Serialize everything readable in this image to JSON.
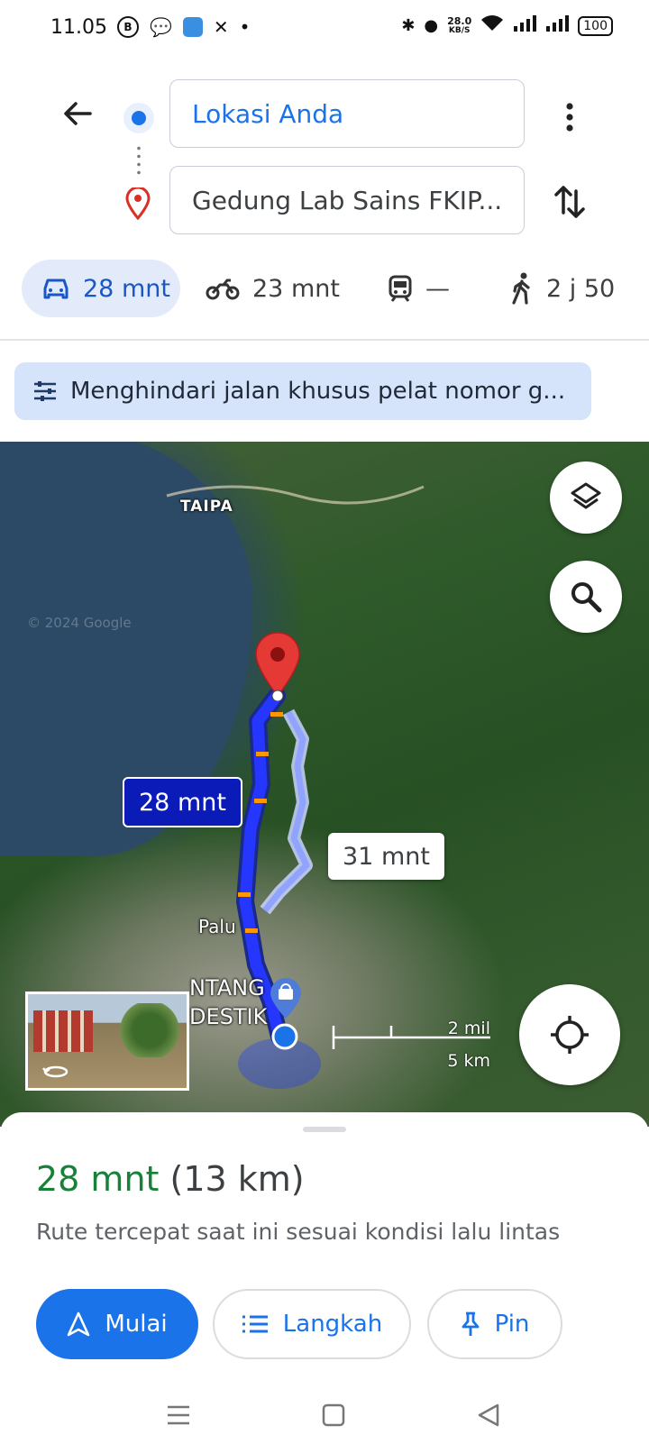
{
  "status_bar": {
    "time": "11.05",
    "speed_value": "28.0",
    "speed_unit": "KB/S",
    "battery": "100"
  },
  "directions": {
    "origin": "Lokasi Anda",
    "destination": "Gedung Lab Sains FKIP..."
  },
  "modes": [
    {
      "name": "car",
      "label": "28 mnt",
      "active": true
    },
    {
      "name": "motorcycle",
      "label": "23 mnt",
      "active": false
    },
    {
      "name": "transit",
      "label": "—",
      "active": false
    },
    {
      "name": "walk",
      "label": "2 j 50",
      "active": false
    }
  ],
  "options_chip": "Menghindari jalan khusus pelat nomor g...",
  "map": {
    "labels": {
      "taipa": "TAIPA",
      "palu": "Palu",
      "ntang": "NTANG",
      "destik": "DESTIK",
      "copyright": "© 2024 Google"
    },
    "route_primary": "28 mnt",
    "route_alt": "31 mnt",
    "scale_miles": "2 mil",
    "scale_km": "5 km",
    "accent": "#1a73e8",
    "route_color": "#1f3bff",
    "pin_color": "#e53935"
  },
  "sheet": {
    "duration": "28 mnt",
    "distance": "(13 km)",
    "description": "Rute tercepat saat ini sesuai kondisi lalu lintas",
    "buttons": {
      "start": "Mulai",
      "steps": "Langkah",
      "pin": "Pin"
    }
  }
}
